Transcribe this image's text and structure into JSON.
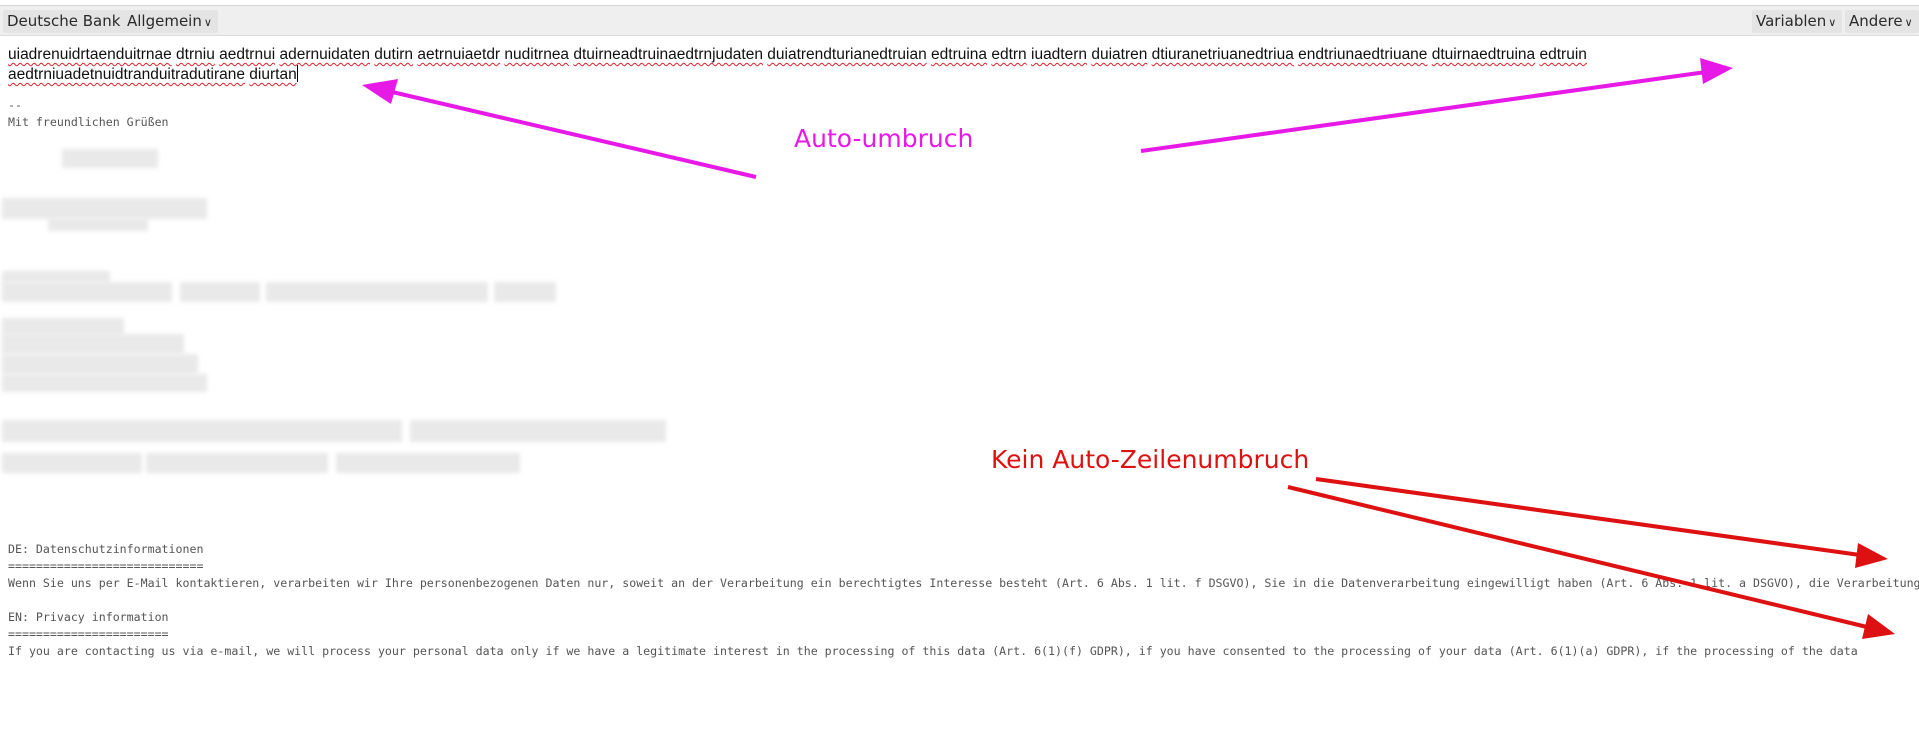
{
  "toolbar": {
    "account_label": "Deutsche Bank",
    "category_label": "Allgemein",
    "variables_label": "Variablen",
    "other_label": "Andere"
  },
  "editor": {
    "body_words": [
      "uiadrenuidrtaenduitrnae",
      "dtrniu",
      "aedtrnui",
      "adernuidaten",
      "dutirn",
      "aetrnuiaetdr",
      "nuditrnea",
      "dtuirneadtruinaedtrnjudaten",
      "duiatrendturianedtruian",
      "edtruina",
      "edtrn",
      "iuadtern",
      "duiatren",
      "dtiuranetriuanedtriua",
      "endtriunaedtriuane",
      "dtuirnaedtruina",
      "edtruin",
      "aedtrniuadetnuidtranduitradutirane",
      "diurtan"
    ],
    "sig_separator": "--",
    "sig_greeting": "Mit freundlichen Grüßen",
    "de_heading": "DE: Datenschutzinformationen",
    "de_underline": "============================",
    "de_text": "Wenn Sie uns per E-Mail kontaktieren, verarbeiten wir Ihre personenbezogenen Daten nur, soweit an der Verarbeitung ein berechtigtes Interesse besteht (Art. 6 Abs. 1 lit. f DSGVO), Sie in die Datenverarbeitung eingewilligt haben (Art. 6 Abs. 1 lit. a DSGVO), die Verarbeitung",
    "en_heading": "EN: Privacy information",
    "en_underline": "=======================",
    "en_text": "If you are contacting us via e-mail, we will process your personal data only if we have a legitimate interest in the processing of this data (Art. 6(1)(f) GDPR), if you have consented to the processing of your data (Art. 6(1)(a) GDPR), if the processing of the data"
  },
  "annotations": {
    "auto_wrap": "Auto-umbruch",
    "auto_wrap_color": "#e619e6",
    "no_wrap": "Kein Auto-Zeilenumbruch",
    "no_wrap_color": "#dd1111"
  }
}
